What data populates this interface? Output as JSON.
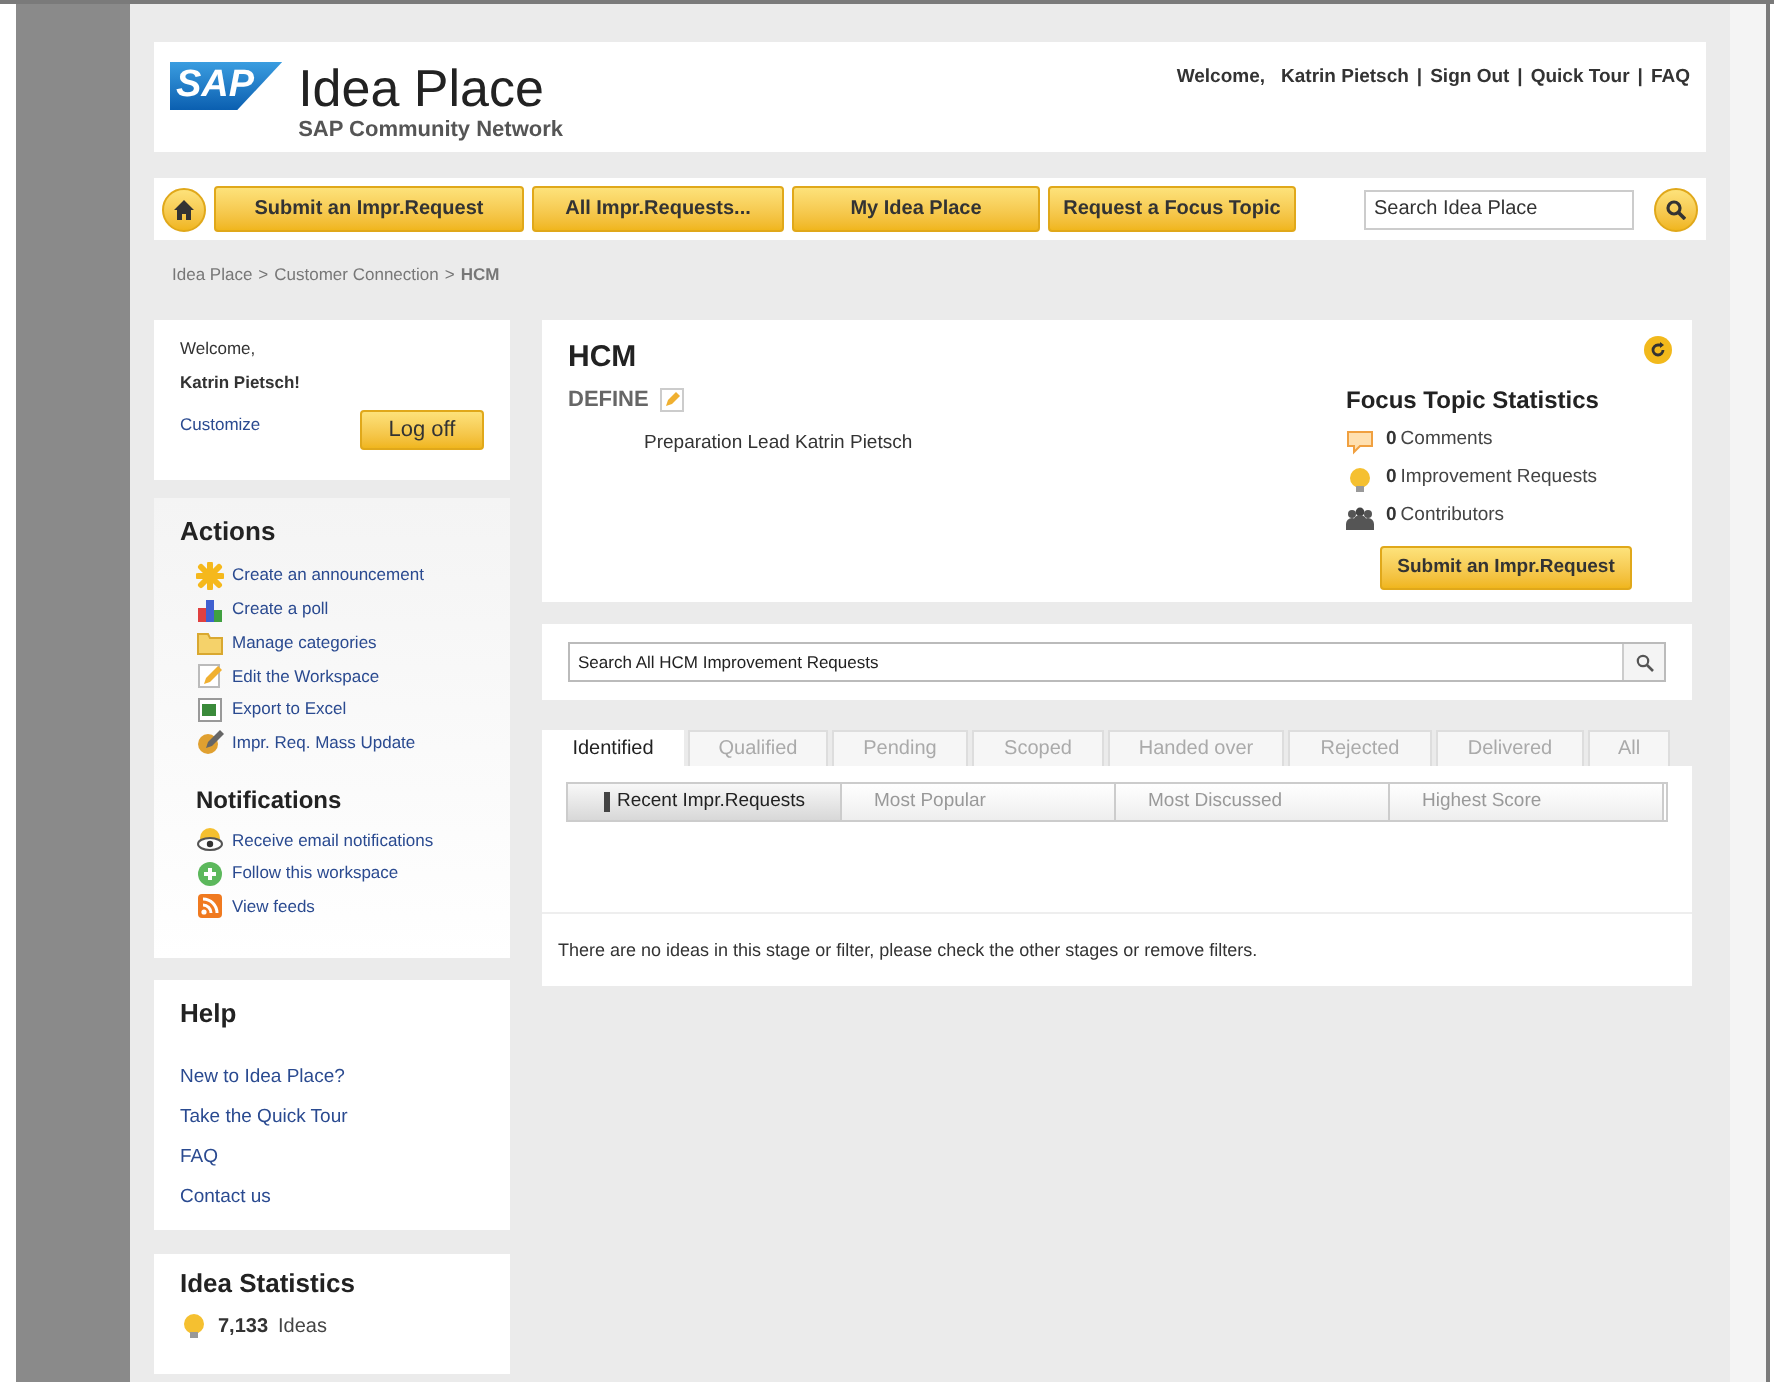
{
  "header": {
    "logo": "SAP",
    "title": "Idea Place",
    "subtitle": "SAP Community Network",
    "welcome": "Welcome,",
    "user_links": [
      "Katrin Pietsch",
      "Sign Out",
      "Quick Tour",
      "FAQ"
    ],
    "link_separator": "|"
  },
  "nav": {
    "buttons": [
      "Submit an Impr.Request",
      "All Impr.Requests...",
      "My Idea Place",
      "Request a Focus Topic"
    ],
    "search": {
      "placeholder": "Search Idea Place"
    }
  },
  "breadcrumb": {
    "items": [
      "Idea Place",
      "Customer Connection",
      "HCM"
    ],
    "separator": ">"
  },
  "sidebar": {
    "welcome": "Welcome,",
    "user": "Katrin Pietsch!",
    "customize": "Customize",
    "logoff": "Log off",
    "actions": {
      "title": "Actions",
      "items": [
        {
          "label": "Create an announcement",
          "kind": "star"
        },
        {
          "label": "Create a poll",
          "kind": "chart"
        },
        {
          "label": "Manage categories",
          "kind": "folder"
        },
        {
          "label": "Edit the Workspace",
          "kind": "pencil"
        },
        {
          "label": "Export to Excel",
          "kind": "sheet"
        },
        {
          "label": "Impr. Req. Mass Update",
          "kind": "update"
        }
      ]
    },
    "notifications": {
      "title": "Notifications",
      "items": [
        {
          "label": "Receive email notifications",
          "kind": "eye"
        },
        {
          "label": "Follow this workspace",
          "kind": "plus"
        },
        {
          "label": "View feeds",
          "kind": "feed"
        }
      ]
    },
    "help": {
      "title": "Help",
      "links": [
        "New to Idea Place?",
        "Take the Quick Tour",
        "FAQ",
        "Contact us"
      ]
    },
    "idea_stats": {
      "title": "Idea Statistics",
      "count": "7,133",
      "label": "Ideas"
    }
  },
  "topic": {
    "title": "HCM",
    "stage": "DEFINE",
    "lead": "Preparation Lead Katrin Pietsch",
    "stats": {
      "title": "Focus Topic Statistics",
      "items": [
        {
          "count": "0",
          "label": "Comments",
          "kind": "comment"
        },
        {
          "count": "0",
          "label": "Improvement Requests",
          "kind": "bulb"
        },
        {
          "count": "0",
          "label": "Contributors",
          "kind": "people"
        }
      ]
    },
    "submit": "Submit an Impr.Request"
  },
  "search": {
    "value": "Search All HCM Improvement Requests"
  },
  "stage_tabs": [
    {
      "label": "Identified",
      "selected": true
    },
    {
      "label": "Qualified",
      "selected": false
    },
    {
      "label": "Pending",
      "selected": false
    },
    {
      "label": "Scoped",
      "selected": false
    },
    {
      "label": "Handed over",
      "selected": false
    },
    {
      "label": "Rejected",
      "selected": false
    },
    {
      "label": "Delivered",
      "selected": false
    },
    {
      "label": "All",
      "selected": false
    }
  ],
  "sort_tabs": [
    {
      "label": "Recent Impr.Requests",
      "selected": true
    },
    {
      "label": "Most Popular",
      "selected": false
    },
    {
      "label": "Most Discussed",
      "selected": false
    },
    {
      "label": "Highest Score",
      "selected": false
    }
  ],
  "empty_message": "There are no ideas in this stage or filter, please check the other stages or remove filters."
}
